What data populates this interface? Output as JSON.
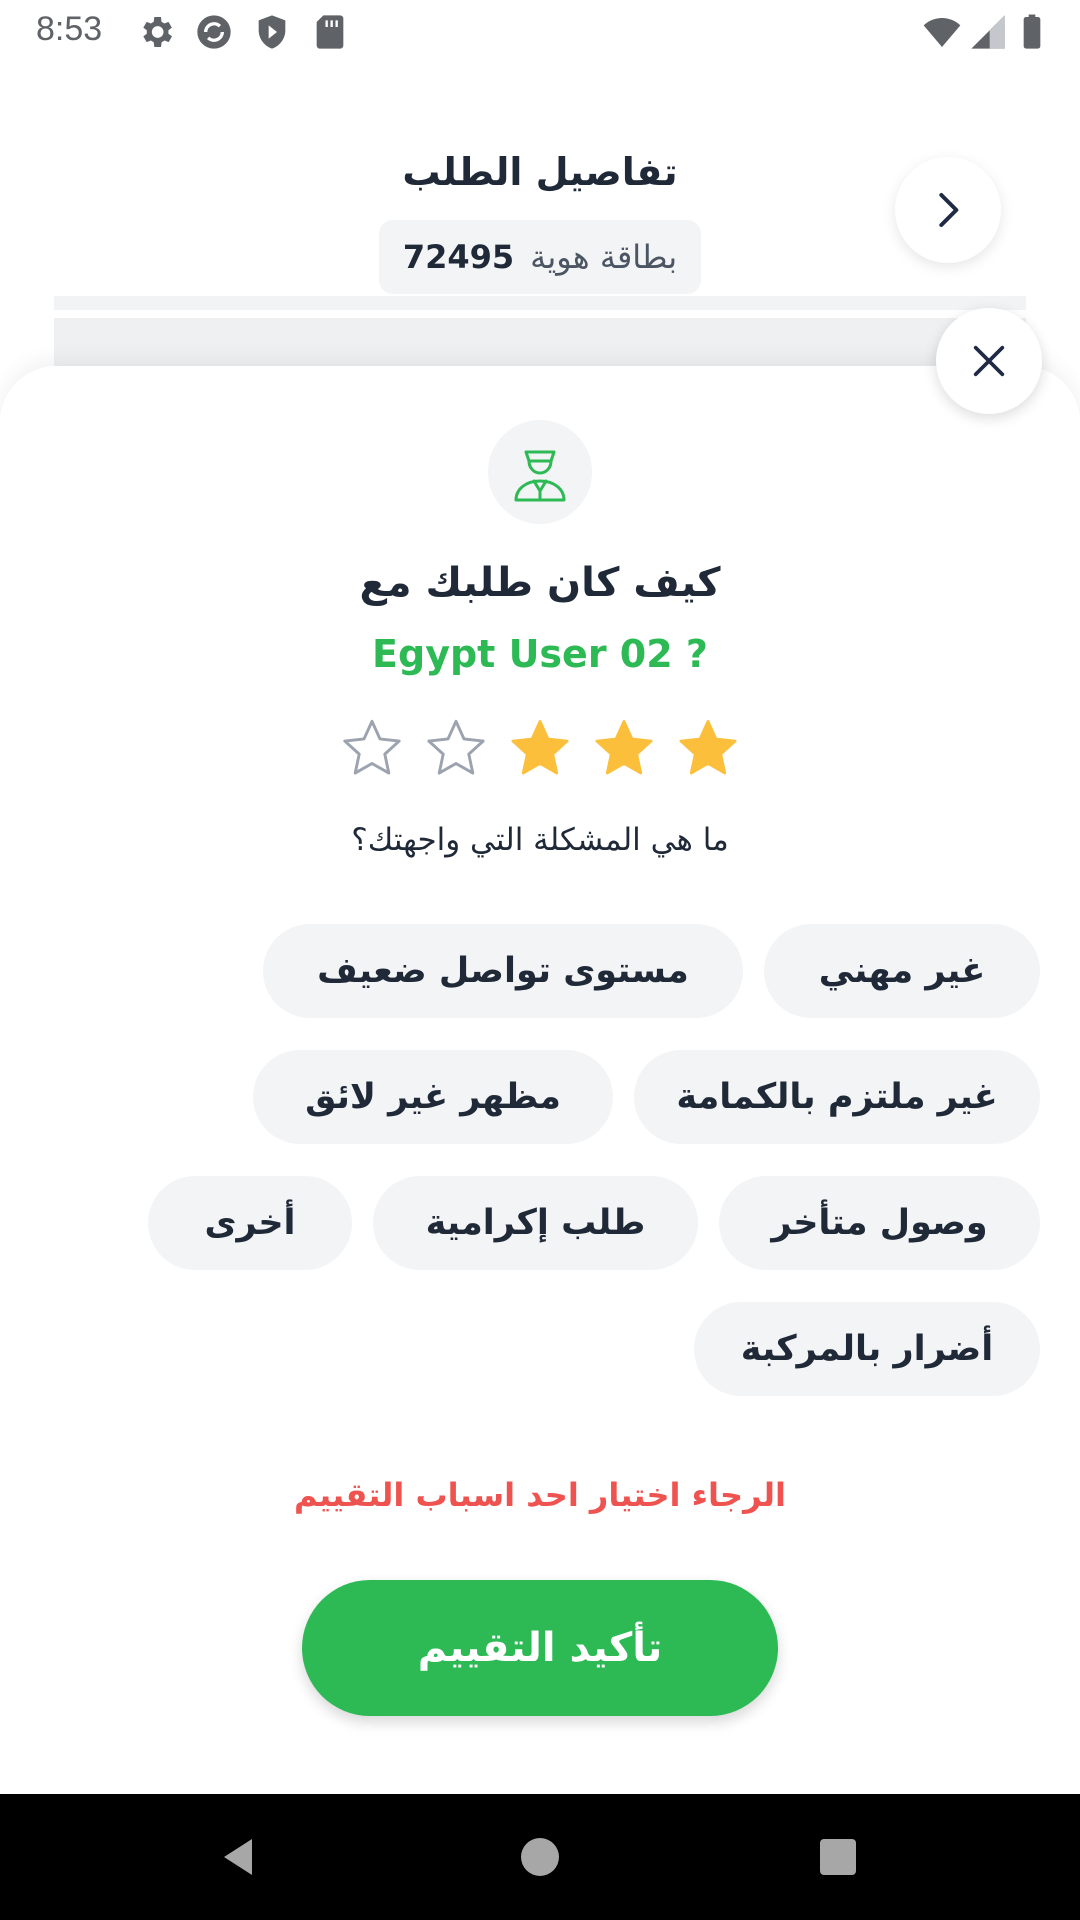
{
  "status_bar": {
    "time": "8:53",
    "left_icons": [
      "gear-icon",
      "sync-icon",
      "shield-play-icon",
      "sd-card-icon"
    ],
    "right_icons": [
      "wifi-icon",
      "signal-icon",
      "battery-icon"
    ]
  },
  "header": {
    "title": "تفاصيل الطلب",
    "id_label": "بطاقة هوية",
    "id_number": "72495"
  },
  "rating_sheet": {
    "question_line1": "كيف كان طلبك مع",
    "question_line2": "Egypt User  02 ?",
    "rating": 3,
    "max_rating": 5,
    "problem_question": "ما هي المشكلة التي واجهتك؟",
    "issues": [
      "غير مهني",
      "مستوى تواصل ضعيف",
      "غير ملتزم بالكمامة",
      "مظهر غير لائق",
      "وصول متأخر",
      "طلب إكرامية",
      "أخرى",
      "أضرار بالمركبة"
    ],
    "error_message": "الرجاء اختيار احد اسباب التقييم",
    "confirm_label": "تأكيد التقييم"
  },
  "colors": {
    "accent_green": "#2dba55",
    "star_filled": "#fbbf3c",
    "error_red": "#ef5350"
  }
}
